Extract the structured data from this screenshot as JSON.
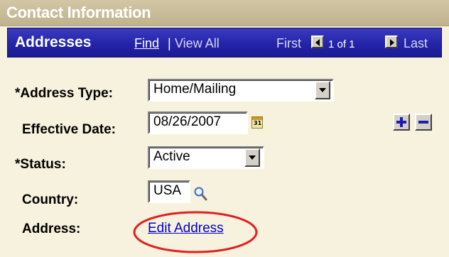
{
  "section": {
    "title": "Contact Information"
  },
  "grid": {
    "title": "Addresses",
    "nav": {
      "find": "Find",
      "separator": "|",
      "view_all": "View All",
      "first": "First",
      "count": "1 of 1",
      "last": "Last"
    }
  },
  "form": {
    "address_type": {
      "label": "*Address Type:",
      "value": "Home/Mailing"
    },
    "effective_date": {
      "label": "Effective Date:",
      "value": "08/26/2007"
    },
    "status": {
      "label": "*Status:",
      "value": "Active"
    },
    "country": {
      "label": "Country:",
      "value": "USA"
    },
    "address": {
      "label": "Address:",
      "link": "Edit Address"
    }
  },
  "icons": {
    "calendar": "calendar-icon",
    "lookup": "magnifier-icon",
    "add_row": "plus-icon",
    "delete_row": "minus-icon",
    "calendar_glyph": "31"
  },
  "colors": {
    "header_bar": "#1b1b94",
    "section_header": "#c8bc98",
    "link": "#0000cc",
    "background": "#f7f2dd",
    "annotation": "#e02020"
  }
}
